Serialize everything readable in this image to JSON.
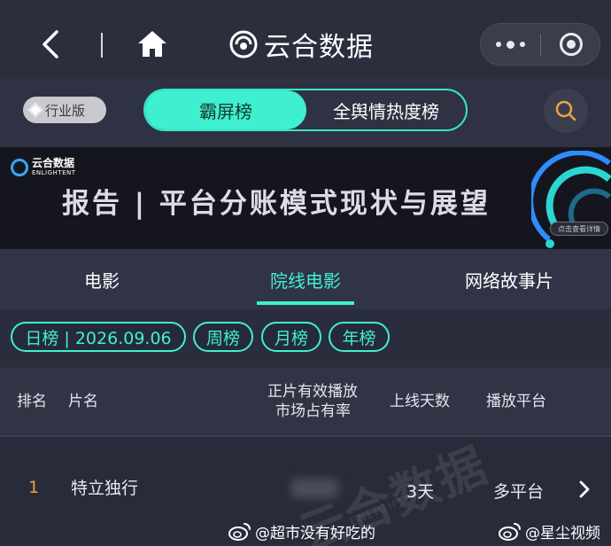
{
  "nav": {
    "brand_name": "云合数据"
  },
  "toolbar": {
    "edition_label": "行业版",
    "tabs": [
      {
        "label": "霸屏榜",
        "active": true
      },
      {
        "label": "全舆情热度榜",
        "active": false
      }
    ]
  },
  "banner": {
    "logo_cn": "云合数据",
    "logo_en": "ENLIGHTENT",
    "title": "报告 | 平台分账模式现状与展望",
    "cta": "点击查看详情"
  },
  "categories": [
    {
      "label": "电影",
      "active": false
    },
    {
      "label": "院线电影",
      "active": true
    },
    {
      "label": "网络故事片",
      "active": false
    }
  ],
  "periods": [
    {
      "label": "日榜 | 2026.09.06",
      "active": true
    },
    {
      "label": "周榜"
    },
    {
      "label": "月榜"
    },
    {
      "label": "年榜"
    }
  ],
  "table": {
    "headers": {
      "rank": "排名",
      "title": "片名",
      "share_line1": "正片有效播放",
      "share_line2": "市场占有率",
      "days": "上线天数",
      "platform": "播放平台"
    },
    "rows": [
      {
        "rank": "1",
        "title": "特立独行",
        "days": "3天",
        "platform": "多平台"
      }
    ]
  },
  "watermark": {
    "text": "云合数据",
    "sub": "ENLIGHTENT"
  },
  "weibo": [
    {
      "handle": "@超市没有好吃的"
    },
    {
      "handle": "@星尘视频"
    }
  ],
  "colors": {
    "accent": "#3ff0d0",
    "rank": "#f0a142",
    "background": "#2a2d3c"
  }
}
